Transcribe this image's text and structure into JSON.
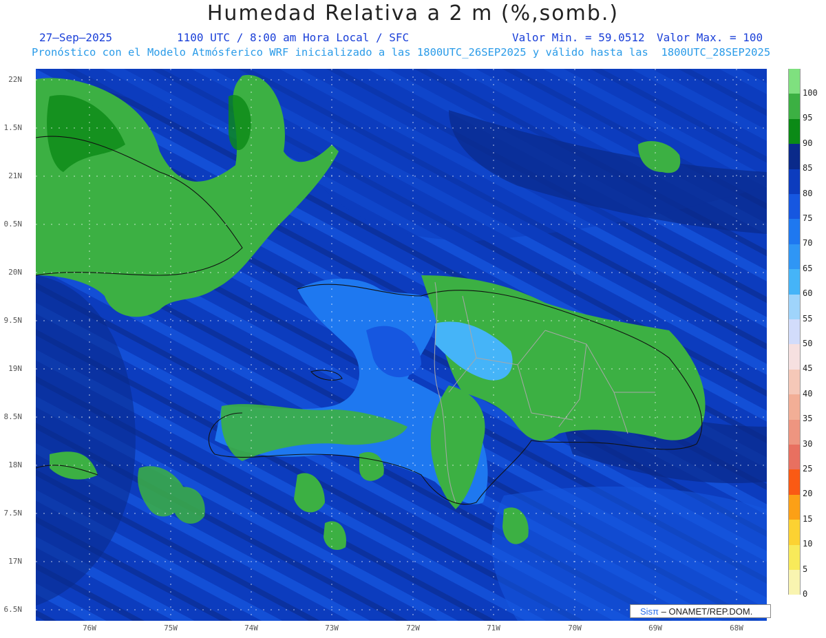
{
  "header": {
    "title": "Humedad Relativa a 2 m (%,somb.)",
    "date": "27–Sep–2025",
    "time": "1100 UTC / 8:00 am Hora Local / SFC",
    "min": "Valor Min. = 59.0512",
    "max": "Valor Max. = 100",
    "subtitle": "Pronóstico con el Modelo Atmósferico WRF inicializado a las 1800UTC_26SEP2025 y válido hasta las  1800UTC_28SEP2025"
  },
  "lat_labels": [
    "22N",
    "1.5N",
    "21N",
    "0.5N",
    "20N",
    "9.5N",
    "19N",
    "8.5N",
    "18N",
    "7.5N",
    "17N",
    "6.5N"
  ],
  "lon_labels": [
    "76W",
    "75W",
    "74W",
    "73W",
    "72W",
    "71W",
    "70W",
    "69W",
    "68W"
  ],
  "colorbar": {
    "labels": [
      "100",
      "95",
      "90",
      "85",
      "80",
      "75",
      "70",
      "65",
      "60",
      "55",
      "50",
      "45",
      "40",
      "35",
      "30",
      "25",
      "20",
      "15",
      "10",
      "5",
      "0"
    ],
    "colors": [
      "#7fe07f",
      "#3cb043",
      "#0b8a16",
      "#0a2a8a",
      "#0c3cbe",
      "#1657e0",
      "#1e78f0",
      "#2f96f5",
      "#45b4f8",
      "#9fd4fb",
      "#d2dcfb",
      "#f6e0e0",
      "#f5c8b8",
      "#f2ae96",
      "#ee9580",
      "#e87060",
      "#fa5a14",
      "#fca016",
      "#fcd232",
      "#f8ea5a",
      "#f9f4b0"
    ]
  },
  "credit": {
    "logo": "Sisπ",
    "text": "– ONAMET/REP.DOM."
  },
  "palette": {
    "ocean_dark": "#0a2a8a",
    "ocean": "#0c3cbe",
    "ocean_light": "#1657e0",
    "moist_light": "#1e78f0",
    "dry": "#45b4f8",
    "land_green": "#3cb043",
    "land_dark_green": "#0b8a16"
  }
}
